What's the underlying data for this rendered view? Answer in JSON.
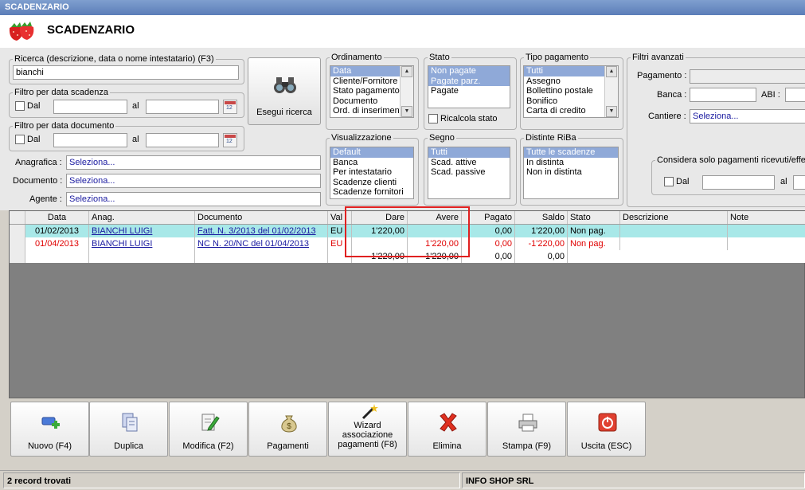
{
  "window": {
    "title": "SCADENZARIO"
  },
  "header": {
    "title": "SCADENZARIO",
    "icon": "strawberry-icon"
  },
  "search": {
    "label": "Ricerca (descrizione, data o nome intestatario) (F3)",
    "value": "bianchi",
    "button_label": "Esegui ricerca"
  },
  "filter_scadenza": {
    "label": "Filtro per data scadenza",
    "dal": "Dal",
    "al": "al"
  },
  "filter_documento": {
    "label": "Filtro per data documento",
    "dal": "Dal",
    "al": "al"
  },
  "fields": {
    "anagrafica_label": "Anagrafica :",
    "anagrafica_value": "Seleziona...",
    "documento_label": "Documento :",
    "documento_value": "Seleziona...",
    "agente_label": "Agente :",
    "agente_value": "Seleziona..."
  },
  "ordinamento": {
    "label": "Ordinamento",
    "items": [
      "Data",
      "Cliente/Fornitore",
      "Stato pagamento",
      "Documento",
      "Ord. di inserimento"
    ]
  },
  "stato": {
    "label": "Stato",
    "items": [
      "Non pagate",
      "Pagate parz.",
      "Pagate"
    ],
    "ricalcola": "Ricalcola stato"
  },
  "tipo_pagamento": {
    "label": "Tipo pagamento",
    "items": [
      "Tutti",
      "Assegno",
      "Bollettino postale",
      "Bonifico",
      "Carta di credito"
    ]
  },
  "visualizzazione": {
    "label": "Visualizzazione",
    "items": [
      "Default",
      "Banca",
      "Per intestatario",
      "Scadenze clienti",
      "Scadenze fornitori"
    ]
  },
  "segno": {
    "label": "Segno",
    "items": [
      "Tutti",
      "Scad. attive",
      "Scad. passive"
    ]
  },
  "distinte": {
    "label": "Distinte RiBa",
    "items": [
      "Tutte le scadenze",
      "In distinta",
      "Non in distinta"
    ]
  },
  "filtri_avanzati": {
    "label": "Filtri avanzati",
    "pagamento_label": "Pagamento :",
    "banca_label": "Banca :",
    "abi_label": "ABI :",
    "cantiere_label": "Cantiere :",
    "cantiere_value": "Seleziona...",
    "considera_label": "Considera solo pagamenti ricevuti/effe",
    "dal": "Dal",
    "al": "al"
  },
  "table": {
    "columns": [
      "Data",
      "Anag.",
      "Documento",
      "Val",
      "Dare",
      "Avere",
      "Pagato",
      "Saldo",
      "Stato",
      "Descrizione",
      "Note"
    ],
    "rows": [
      {
        "data": "01/02/2013",
        "anag": "BIANCHI LUIGI",
        "documento": "Fatt. N. 3/2013 del 01/02/2013",
        "val": "EU",
        "dare": "1'220,00",
        "avere": "",
        "pagato": "0,00",
        "saldo": "1'220,00",
        "stato": "Non pag.",
        "descrizione": "",
        "note": ""
      },
      {
        "data": "01/04/2013",
        "anag": "BIANCHI LUIGI",
        "documento": "NC N. 20/NC del 01/04/2013",
        "val": "EU",
        "dare": "",
        "avere": "1'220,00",
        "pagato": "0,00",
        "saldo": "-1'220,00",
        "stato": "Non pag.",
        "descrizione": "",
        "note": ""
      }
    ],
    "totals": {
      "dare": "1'220,00",
      "avere": "1'220,00",
      "pagato": "0,00",
      "saldo": "0,00"
    }
  },
  "toolbar": {
    "nuovo": "Nuovo (F4)",
    "duplica": "Duplica",
    "modifica": "Modifica (F2)",
    "pagamenti": "Pagamenti",
    "wizard_1": "Wizard",
    "wizard_2": "associazione",
    "wizard_3": "pagamenti (F8)",
    "elimina": "Elimina",
    "stampa": "Stampa (F9)",
    "uscita": "Uscita (ESC)"
  },
  "status": {
    "records": "2 record trovati",
    "company": "INFO SHOP SRL"
  },
  "colors": {
    "selection": "#8fa9d8",
    "row_highlight": "#a8e8e8",
    "negative": "#e00000",
    "link": "#1a1aa0",
    "annotation": "#e02020"
  }
}
